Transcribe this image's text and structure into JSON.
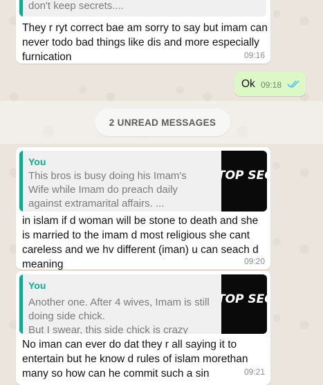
{
  "colors": {
    "accent": "#13a88f",
    "incoming_bubble": "#ffffff",
    "outgoing_bubble": "#dcf8c6",
    "read_ticks": "#4fc3f7",
    "chat_background": "#ece5dd"
  },
  "messages": [
    {
      "quote_tail": "don't keep secrets....",
      "text": "They r ryt correct bae am sorry to say but imam can never todo bad things like dis and more especially furnication",
      "time": "09:16"
    },
    {
      "text": "Ok",
      "time": "09:18",
      "status_icon": "double-check-read-icon"
    },
    {
      "quote": {
        "author": "You",
        "text": "This bros is busy doing his Imam's Wife while Imam do preach daily against extramarital affairs. ...",
        "thumb_text": "TOP SECRET"
      },
      "text": "in islam if d woman will be stone to death and she is married to the imam d most religious she cant careless and we hv different (iman) u can seach d meaning",
      "time": "09:20"
    },
    {
      "quote": {
        "author": "You",
        "text": "Another one. After 4 wives, Imam is still doing side chick.\nBut I swear, this side chick is crazy",
        "thumb_text": "TOP SECRET"
      },
      "text": "No iman can ever do dat they r all saying it to entertain but he know d rules of islam morethan many so how can he commit such a  sin",
      "time": "09:21"
    }
  ],
  "unread_banner": "2 UNREAD MESSAGES"
}
